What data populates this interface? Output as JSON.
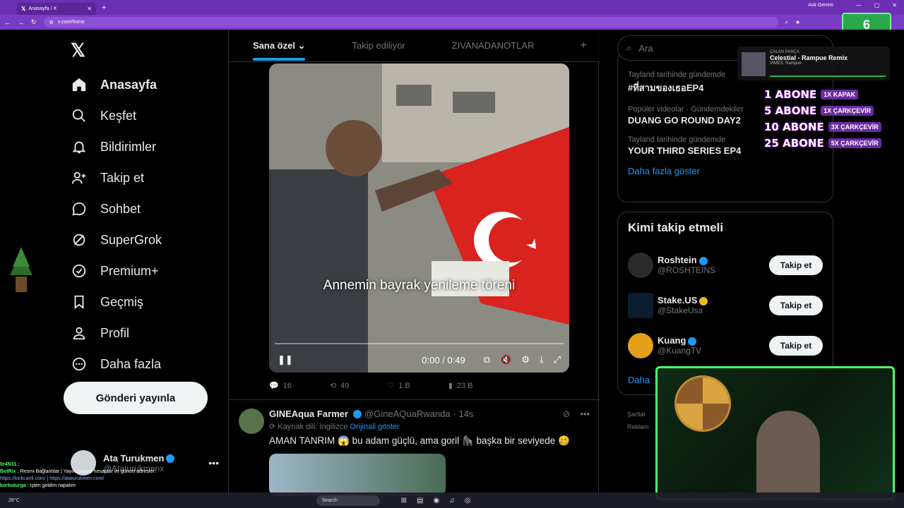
{
  "browser": {
    "tab_title": "Anasayfa / X",
    "url": "x.com/home",
    "ask_gemini": "Ask Gemini",
    "green_badge": "6"
  },
  "sidebar": {
    "items": [
      {
        "label": "Anasayfa",
        "icon": "home-icon"
      },
      {
        "label": "Keşfet",
        "icon": "search-icon"
      },
      {
        "label": "Bildirimler",
        "icon": "bell-icon"
      },
      {
        "label": "Takip et",
        "icon": "add-person-icon"
      },
      {
        "label": "Sohbet",
        "icon": "chat-icon"
      },
      {
        "label": "SuperGrok",
        "icon": "grok-icon"
      },
      {
        "label": "Premium+",
        "icon": "verified-icon"
      },
      {
        "label": "Geçmiş",
        "icon": "bookmark-icon"
      },
      {
        "label": "Profil",
        "icon": "person-icon"
      },
      {
        "label": "Daha fazla",
        "icon": "more-circle-icon"
      }
    ],
    "post_button": "Gönderi yayınla",
    "account": {
      "name": "Ata Turukmen",
      "handle": "@Ataturukmenx"
    }
  },
  "feed": {
    "tabs": [
      "Sana özel",
      "Takip ediliyor",
      "ZIVANADANOTLAR"
    ],
    "video": {
      "caption": "Annemin bayrak yenileme töreni",
      "time": "0:00 / 0:49"
    },
    "actions": {
      "replies": "16",
      "reposts": "49",
      "likes": "1 B",
      "views": "23 B"
    },
    "tweet2": {
      "name": "GINEAqua Farmer",
      "handle": "@GineAQuaRwanda",
      "time": "· 14s",
      "source_lang": "Kaynak dili: İngilizce",
      "show_original": "Orijinali göster",
      "text": "AMAN TANRIM 😱 bu adam güçlü, ama goril 🦍 başka bir seviyede 🥴"
    }
  },
  "right": {
    "search_placeholder": "Ara",
    "trends": [
      {
        "context": "Tayland tarihinde gündemde",
        "title": "#ที่สามของเธอEP4"
      },
      {
        "context": "Popüler videolar · Gündemdekiler",
        "title": "DUANG GO ROUND DAY2"
      },
      {
        "context": "Tayland tarihinde gündemde",
        "title": "YOUR THIRD SERIES EP4"
      }
    ],
    "trends_more": "Daha fazla göster",
    "who_to_follow": {
      "title": "Kimi takip etmeli",
      "users": [
        {
          "name": "Roshtein",
          "handle": "@ROSHTEINS",
          "button": "Takip et"
        },
        {
          "name": "Stake.US",
          "handle": "@StakeUsa",
          "button": "Takip et"
        },
        {
          "name": "Kuang",
          "handle": "@KuangTV",
          "button": "Takip et"
        }
      ],
      "more": "Daha"
    },
    "footer": [
      "Şartlar",
      "Reklam"
    ]
  },
  "overlay": {
    "now_playing": {
      "label": "ÇALAN PARÇA",
      "song": "Celestial - Rampue Remix",
      "artist": "VIMES, Rampue"
    },
    "subs": [
      {
        "count": "1 ABONE",
        "reward": "1X KAPAK"
      },
      {
        "count": "5 ABONE",
        "reward": "1X ÇARKÇEVİR"
      },
      {
        "count": "10 ABONE",
        "reward": "3X ÇARKÇEVİR"
      },
      {
        "count": "25 ABONE",
        "reward": "5X ÇARKÇEVİR"
      }
    ],
    "chat": [
      {
        "user": "0r4N31 :",
        "text": ""
      },
      {
        "user": "BotRix :",
        "text": "Resmi Bağlantılar | Yayın, sosyal hesaplar ve güncel adresler:"
      },
      {
        "user": "",
        "text": "https://kickcanli.com/ | https://ataturukmen.com/"
      },
      {
        "user": "korkuturga :",
        "text": "işten geldim napalım"
      }
    ]
  },
  "taskbar": {
    "search": "Search",
    "temp": "28°C"
  }
}
